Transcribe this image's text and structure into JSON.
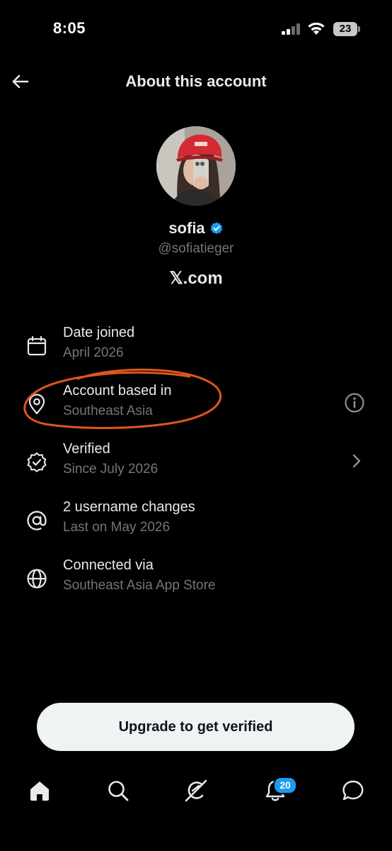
{
  "status_bar": {
    "time": "8:05",
    "battery": "23"
  },
  "header": {
    "title": "About this account"
  },
  "profile": {
    "name": "sofia",
    "handle": "@sofiatieger",
    "site": "𝕏.com",
    "verified_badge_color": "#1d9bf0"
  },
  "info_rows": [
    {
      "icon": "calendar-icon",
      "label": "Date joined",
      "value": "April 2026"
    },
    {
      "icon": "location-pin-icon",
      "label": "Account based in",
      "value": "Southeast Asia",
      "action_icon": "info-icon"
    },
    {
      "icon": "verified-badge-icon",
      "label": "Verified",
      "value": "Since July 2026",
      "action_icon": "chevron-right-icon"
    },
    {
      "icon": "at-sign-icon",
      "label": "2 username changes",
      "value": "Last on May 2026"
    },
    {
      "icon": "globe-icon",
      "label": "Connected via",
      "value": "Southeast Asia App Store"
    }
  ],
  "annotation": {
    "color": "#e0561c"
  },
  "cta": {
    "label": "Upgrade to get verified"
  },
  "tabbar": {
    "items": [
      {
        "icon": "home-icon"
      },
      {
        "icon": "search-icon"
      },
      {
        "icon": "grok-icon"
      },
      {
        "icon": "notifications-icon",
        "badge": "20"
      },
      {
        "icon": "messages-icon"
      }
    ]
  },
  "colors": {
    "background": "#000000",
    "text": "#e7e9ea",
    "muted": "#71767b",
    "accent": "#1d9bf0"
  }
}
